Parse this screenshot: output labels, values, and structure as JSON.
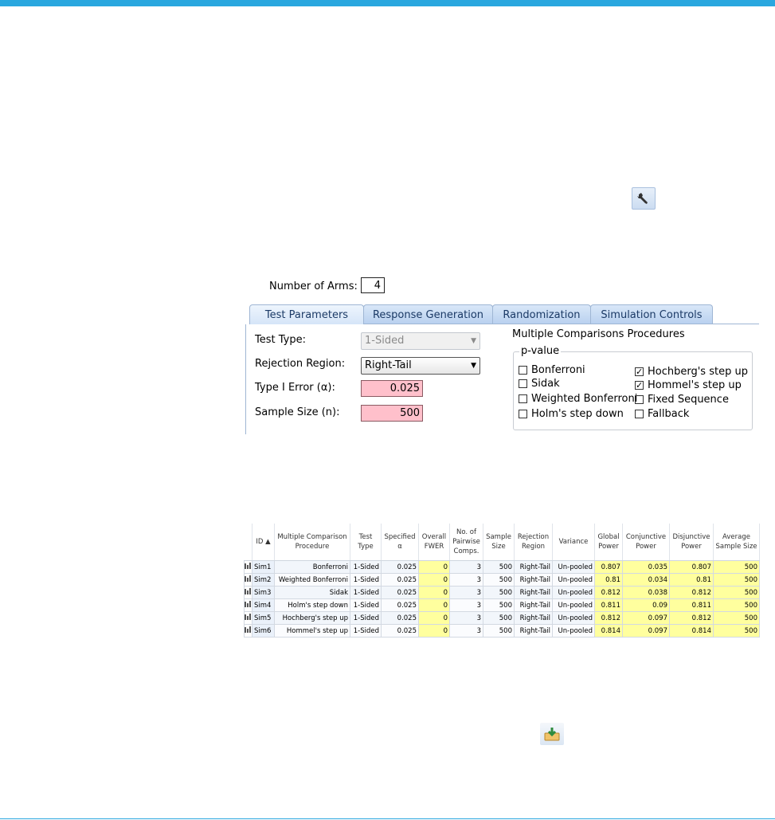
{
  "input": {
    "arms_label": "Number of Arms:",
    "arms_value": "4",
    "tabs": [
      {
        "label": "Test Parameters"
      },
      {
        "label": "Response Generation"
      },
      {
        "label": "Randomization"
      },
      {
        "label": "Simulation Controls"
      }
    ],
    "test_type_label": "Test Type:",
    "test_type_value": "1-Sided",
    "rejection_label": "Rejection Region:",
    "rejection_value": "Right-Tail",
    "alpha_label": "Type I Error (α):",
    "alpha_value": "0.025",
    "n_label": "Sample Size (n):",
    "n_value": "500",
    "mcp_title": "Multiple Comparisons Procedures",
    "pvalue_legend": "p-value",
    "checkboxes": [
      {
        "label": "Bonferroni",
        "checked": false
      },
      {
        "label": "Sidak",
        "checked": false
      },
      {
        "label": "Weighted Bonferroni",
        "checked": false
      },
      {
        "label": "Holm's step down",
        "checked": false
      },
      {
        "label": "Hochberg's step up",
        "checked": true
      },
      {
        "label": "Hommel's step up",
        "checked": true
      },
      {
        "label": "Fixed Sequence",
        "checked": false
      },
      {
        "label": "Fallback",
        "checked": false
      }
    ]
  },
  "table": {
    "headers": [
      "",
      "ID ▲",
      "Multiple Comparison Procedure",
      "Test Type",
      "Specified α",
      "Overall FWER",
      "No. of Pairwise Comps.",
      "Sample Size",
      "Rejection Region",
      "Variance",
      "Global Power",
      "Conjunctive Power",
      "Disjunctive Power",
      "Average Sample Size"
    ],
    "rows": [
      {
        "id": "Sim1",
        "mcp": "Bonferroni",
        "type": "1-Sided",
        "alpha": "0.025",
        "fwer": "0",
        "comps": "3",
        "n": "500",
        "rej": "Right-Tail",
        "var": "Un-pooled",
        "gp": "0.807",
        "cp": "0.035",
        "dp": "0.807",
        "avg": "500"
      },
      {
        "id": "Sim2",
        "mcp": "Weighted Bonferroni",
        "type": "1-Sided",
        "alpha": "0.025",
        "fwer": "0",
        "comps": "3",
        "n": "500",
        "rej": "Right-Tail",
        "var": "Un-pooled",
        "gp": "0.81",
        "cp": "0.034",
        "dp": "0.81",
        "avg": "500"
      },
      {
        "id": "Sim3",
        "mcp": "Sidak",
        "type": "1-Sided",
        "alpha": "0.025",
        "fwer": "0",
        "comps": "3",
        "n": "500",
        "rej": "Right-Tail",
        "var": "Un-pooled",
        "gp": "0.812",
        "cp": "0.038",
        "dp": "0.812",
        "avg": "500"
      },
      {
        "id": "Sim4",
        "mcp": "Holm's step down",
        "type": "1-Sided",
        "alpha": "0.025",
        "fwer": "0",
        "comps": "3",
        "n": "500",
        "rej": "Right-Tail",
        "var": "Un-pooled",
        "gp": "0.811",
        "cp": "0.09",
        "dp": "0.811",
        "avg": "500"
      },
      {
        "id": "Sim5",
        "mcp": "Hochberg's step up",
        "type": "1-Sided",
        "alpha": "0.025",
        "fwer": "0",
        "comps": "3",
        "n": "500",
        "rej": "Right-Tail",
        "var": "Un-pooled",
        "gp": "0.812",
        "cp": "0.097",
        "dp": "0.812",
        "avg": "500"
      },
      {
        "id": "Sim6",
        "mcp": "Hommel's step up",
        "type": "1-Sided",
        "alpha": "0.025",
        "fwer": "0",
        "comps": "3",
        "n": "500",
        "rej": "Right-Tail",
        "var": "Un-pooled",
        "gp": "0.814",
        "cp": "0.097",
        "dp": "0.814",
        "avg": "500"
      }
    ]
  },
  "icons": {
    "wrench": "wrench-icon",
    "download": "download-icon",
    "row": "design-icon"
  },
  "colors": {
    "accent": "#2aa7df",
    "highlight": "#ffff9e",
    "required": "#ffc0cb"
  }
}
